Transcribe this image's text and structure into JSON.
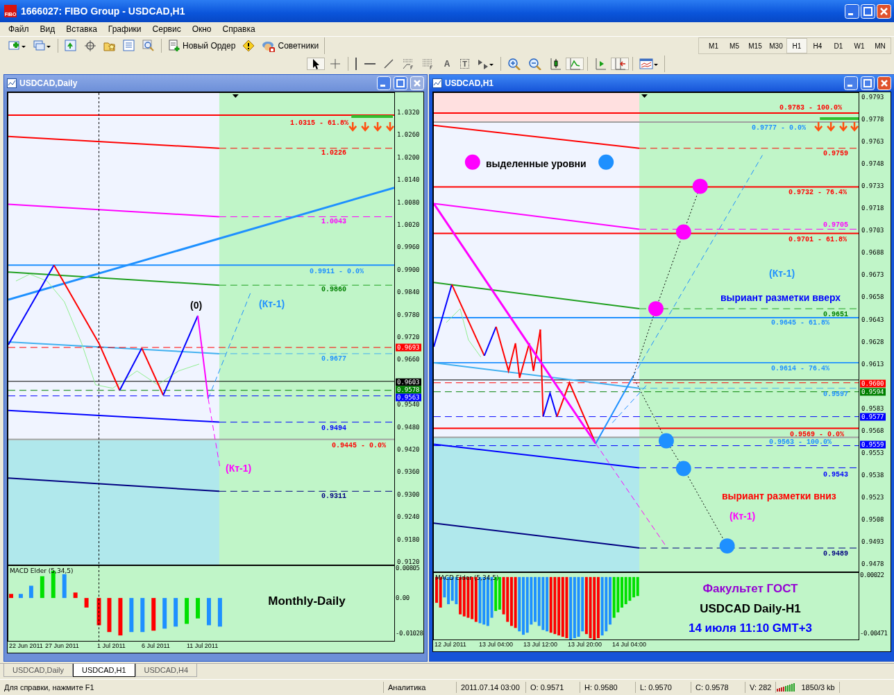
{
  "window": {
    "logo_text": "FIBO",
    "title": "1666027: FIBO Group - USDCAD,H1"
  },
  "menu": [
    "Файл",
    "Вид",
    "Вставка",
    "Графики",
    "Сервис",
    "Окно",
    "Справка"
  ],
  "toolbar": [
    {
      "kind": "new-chart"
    },
    {
      "kind": "profiles"
    },
    {
      "kind": "sep"
    },
    {
      "kind": "market-watch"
    },
    {
      "kind": "navigator-crosshair"
    },
    {
      "kind": "favorites"
    },
    {
      "kind": "terminal"
    },
    {
      "kind": "tester"
    },
    {
      "kind": "sep"
    },
    {
      "kind": "new-order",
      "label": "Новый Ордер"
    },
    {
      "kind": "warning"
    },
    {
      "kind": "experts",
      "label": "Советники"
    }
  ],
  "timeframes": [
    {
      "label": "M1",
      "selected": false
    },
    {
      "label": "M5",
      "selected": false
    },
    {
      "label": "M15",
      "selected": false
    },
    {
      "label": "M30",
      "selected": false
    },
    {
      "label": "H1",
      "selected": true
    },
    {
      "label": "H4",
      "selected": false
    },
    {
      "label": "D1",
      "selected": false
    },
    {
      "label": "W1",
      "selected": false
    },
    {
      "label": "MN",
      "selected": false
    }
  ],
  "drawing_tools": [
    {
      "kind": "cursor",
      "selected": true
    },
    {
      "kind": "crosshair",
      "selected": false
    },
    {
      "kind": "sep"
    },
    {
      "kind": "vline",
      "selected": false
    },
    {
      "kind": "hline",
      "selected": false
    },
    {
      "kind": "trendline",
      "selected": false
    },
    {
      "kind": "fibo-fan",
      "selected": false
    },
    {
      "kind": "fibo",
      "selected": false
    },
    {
      "kind": "glyph",
      "label": "A",
      "selected": false
    },
    {
      "kind": "boxed-glyph",
      "label": "T",
      "selected": false
    },
    {
      "kind": "arrows",
      "selected": false
    },
    {
      "kind": "sep"
    },
    {
      "kind": "zoom-in",
      "selected": false
    },
    {
      "kind": "zoom-out",
      "selected": false
    },
    {
      "kind": "bars",
      "selected": false
    },
    {
      "kind": "line-chart",
      "selected": true
    },
    {
      "kind": "sep"
    },
    {
      "kind": "autoscroll",
      "selected": false
    },
    {
      "kind": "chart-shift",
      "selected": true
    },
    {
      "kind": "sep"
    },
    {
      "kind": "templates",
      "selected": false
    }
  ],
  "charts": [
    {
      "title": "USDCAD,Daily",
      "active": false,
      "y_axis": [
        "1.0320",
        "1.0260",
        "1.0200",
        "1.0140",
        "1.0080",
        "1.0020",
        "0.9960",
        "0.9900",
        "0.9840",
        "0.9780",
        "0.9720",
        "0.9660",
        "0.9540",
        "0.9480",
        "0.9420",
        "0.9360",
        "0.9300",
        "0.9240",
        "0.9180",
        "0.9120"
      ],
      "price_badges": [
        {
          "text": "0.9693",
          "color": "#ff0000"
        },
        {
          "text": "0.9603",
          "color": "#000000"
        },
        {
          "text": "0.9578",
          "color": "#008000"
        },
        {
          "text": "0.9563",
          "color": "#0000ff"
        }
      ],
      "levels": [
        {
          "text": "1.0315 - 61.8%",
          "color": "#ff0000"
        },
        {
          "text": "1.0226",
          "color": "#ff0000"
        },
        {
          "text": "1.0043",
          "color": "#ff00ff"
        },
        {
          "text": "0.9911 - 0.0%",
          "color": "#1e90ff"
        },
        {
          "text": "0.9860",
          "color": "#008000"
        },
        {
          "text": "0.9677",
          "color": "#1e90ff"
        },
        {
          "text": "0.9494",
          "color": "#0000ff"
        },
        {
          "text": "0.9445 - 0.0%",
          "color": "#ff0000"
        },
        {
          "text": "0.9311",
          "color": "#000080"
        }
      ],
      "annotations": [
        {
          "text": "(0)",
          "color": "#000000"
        },
        {
          "text": "(Кт-1)",
          "color": "#1e90ff"
        },
        {
          "text": "(Кт-1)",
          "color": "#ff00ff"
        }
      ],
      "indicator": {
        "label": "MACD Elder (5,34,5)",
        "y_axis": [
          "0.00805",
          "0.00",
          "-0.01028"
        ],
        "captions": [
          {
            "text": "Monthly-Daily",
            "color": "#000000"
          }
        ]
      },
      "x_axis": [
        "22 Jun 2011",
        "27 Jun 2011",
        "1 Jul 2011",
        "6 Jul 2011",
        "11 Jul 2011"
      ]
    },
    {
      "title": "USDCAD,H1",
      "active": true,
      "y_axis": [
        "0.9793",
        "0.9778",
        "0.9763",
        "0.9748",
        "0.9733",
        "0.9718",
        "0.9703",
        "0.9688",
        "0.9673",
        "0.9658",
        "0.9643",
        "0.9628",
        "0.9613",
        "0.9583",
        "0.9568",
        "0.9553",
        "0.9538",
        "0.9523",
        "0.9508",
        "0.9493",
        "0.9478"
      ],
      "price_badges": [
        {
          "text": "0.9600",
          "color": "#ff0000"
        },
        {
          "text": "0.9594",
          "color": "#008000"
        },
        {
          "text": "0.9577",
          "color": "#0000ff"
        },
        {
          "text": "0.9559",
          "color": "#0000ff"
        }
      ],
      "levels": [
        {
          "text": "0.9783 - 100.0%",
          "color": "#ff0000"
        },
        {
          "text": "0.9777 - 0.0%",
          "color": "#1e90ff"
        },
        {
          "text": "0.9759",
          "color": "#ff0000"
        },
        {
          "text": "0.9732 - 76.4%",
          "color": "#ff0000"
        },
        {
          "text": "0.9705",
          "color": "#ff00ff"
        },
        {
          "text": "0.9701 - 61.8%",
          "color": "#ff0000"
        },
        {
          "text": "0.9651",
          "color": "#008000"
        },
        {
          "text": "0.9645 - 61.8%",
          "color": "#1e90ff"
        },
        {
          "text": "0.9614 - 76.4%",
          "color": "#1e90ff"
        },
        {
          "text": "0.9597",
          "color": "#1e90ff"
        },
        {
          "text": "0.9569 - 0.0%",
          "color": "#ff0000"
        },
        {
          "text": "0.9563 - 100.0%",
          "color": "#1e90ff"
        },
        {
          "text": "0.9543",
          "color": "#0000ff"
        },
        {
          "text": "0.9489",
          "color": "#000080"
        }
      ],
      "annotations": [
        {
          "text": "выделенные уровни",
          "color": "#000000"
        },
        {
          "text": "(Кт-1)",
          "color": "#1e90ff"
        },
        {
          "text": "выриант разметки вверх",
          "color": "#0000ff"
        },
        {
          "text": "выриант разметки вниз",
          "color": "#ff0000"
        },
        {
          "text": "(Кт-1)",
          "color": "#ff00ff"
        }
      ],
      "indicator": {
        "label": "MACD Elder (5,34,5)",
        "y_axis": [
          "0.00022",
          "-0.00471"
        ],
        "captions": [
          {
            "text": "Факультет ГОСТ",
            "color": "#9400d3"
          },
          {
            "text": "USDCAD Daily-H1",
            "color": "#000000"
          },
          {
            "text": "14 июля 11:10 GMT+3",
            "color": "#0000ff"
          }
        ]
      },
      "x_axis": [
        "12 Jul 2011",
        "13 Jul 04:00",
        "13 Jul 12:00",
        "13 Jul 20:00",
        "14 Jul 04:00"
      ]
    }
  ],
  "chart_tabs": [
    {
      "label": "USDCAD,Daily",
      "selected": false
    },
    {
      "label": "USDCAD,H1",
      "selected": true
    },
    {
      "label": "USDCAD,H4",
      "selected": false
    }
  ],
  "status_bar": [
    "Для справки, нажмите F1",
    "Аналитика",
    "2011.07.14 03:00",
    "O: 0.9571",
    "H: 0.9580",
    "L: 0.9570",
    "C: 0.9578",
    "V: 282",
    "1850/3 kb"
  ]
}
